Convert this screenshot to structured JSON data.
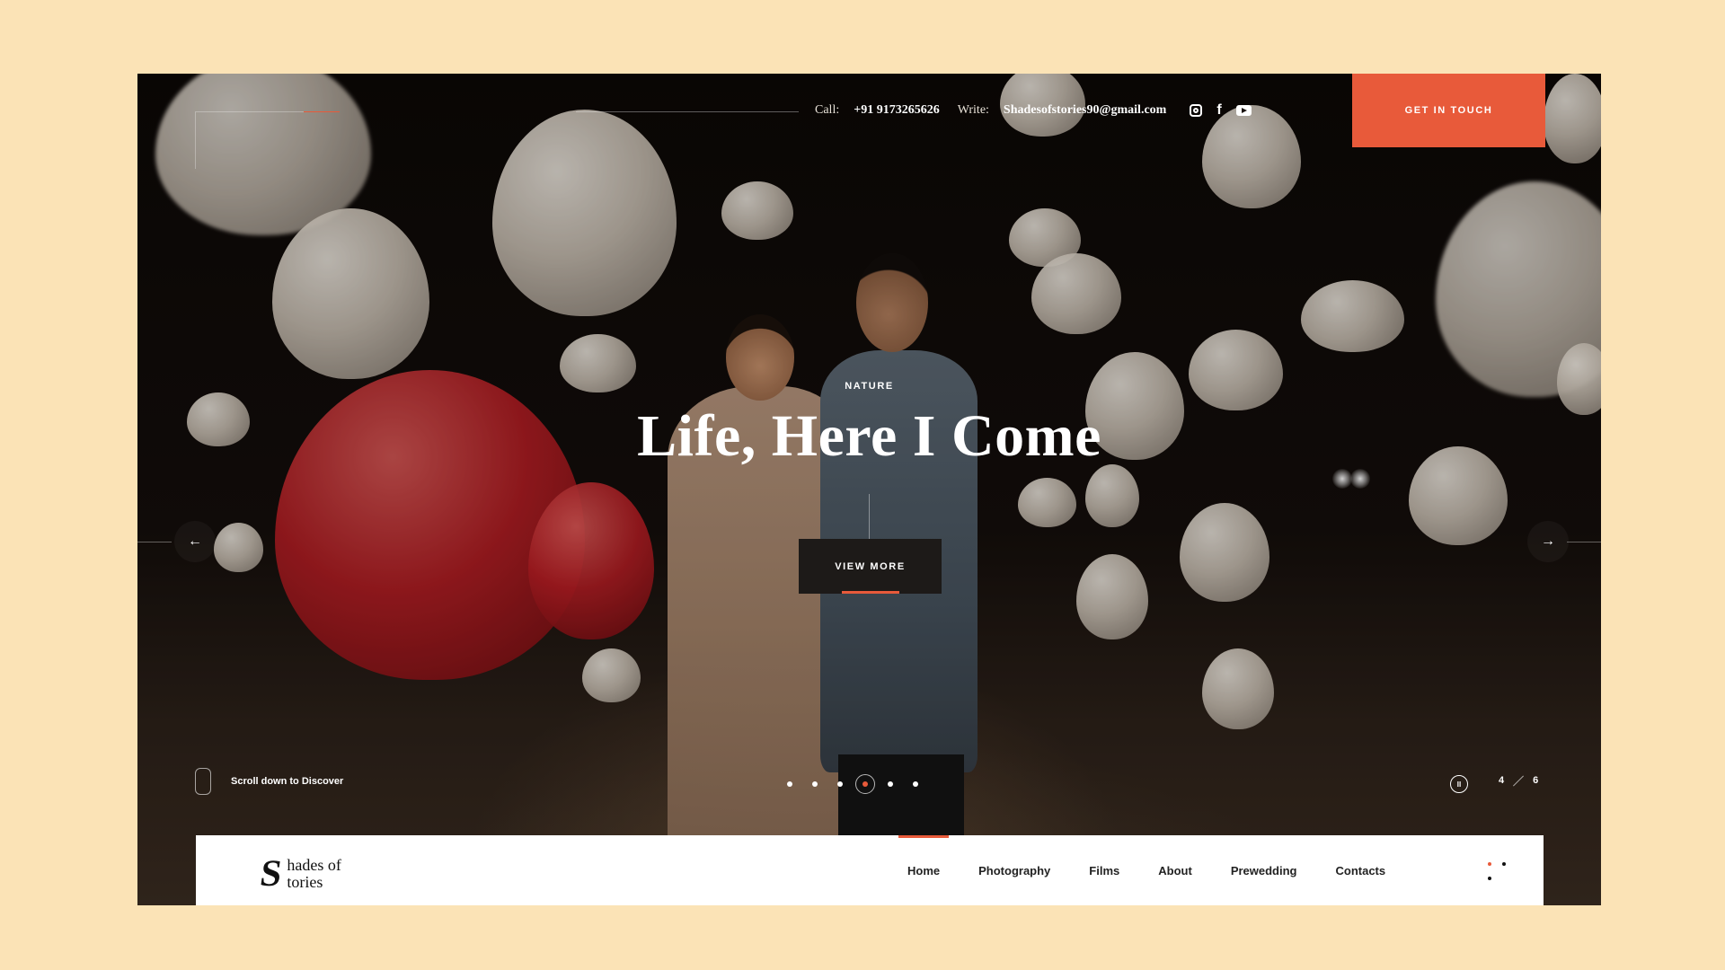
{
  "topbar": {
    "call_label": "Call:",
    "call_value": "+91 9173265626",
    "write_label": "Write:",
    "write_value": "Shadesofstories90@gmail.com",
    "cta_label": "GET IN TOUCH"
  },
  "socials": [
    {
      "icon": "instagram-icon"
    },
    {
      "icon": "facebook-icon",
      "glyph": "f"
    },
    {
      "icon": "youtube-icon"
    }
  ],
  "hero": {
    "eyebrow": "NATURE",
    "headline": "Life, Here I Come",
    "button_label": "VIEW MORE",
    "prev_arrow": "←",
    "next_arrow": "→",
    "scroll_text": "Scroll down to Discover",
    "slide_current": "4",
    "slide_total": "6",
    "pause_glyph": "II",
    "slide_count": 6,
    "active_slide": 4
  },
  "brand": {
    "logo_letter": "S",
    "logo_line1": "hades of",
    "logo_line2": "tories"
  },
  "nav": {
    "items": [
      "Home",
      "Photography",
      "Films",
      "About",
      "Prewedding",
      "Contacts"
    ],
    "active": "Home"
  },
  "colors": {
    "accent": "#e85a3a",
    "page_background": "#fbe3b6",
    "button_dark": "#1d1a18"
  }
}
